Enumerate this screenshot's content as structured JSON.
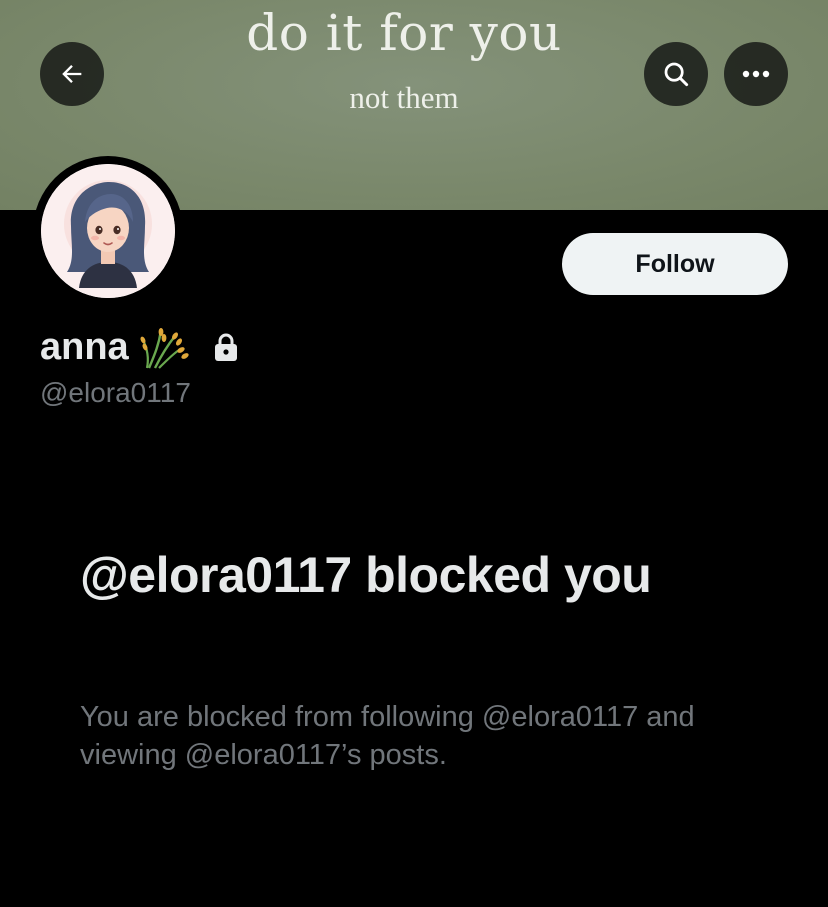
{
  "banner": {
    "title": "do it for you",
    "subtitle": "not them",
    "color": "#7b8a6c"
  },
  "header": {
    "back_icon": "arrow-left-icon",
    "search_icon": "search-icon",
    "more_icon": "more-horizontal-icon"
  },
  "profile": {
    "display_name": "anna",
    "name_emoji": "sheaf-of-rice-icon",
    "protected_icon": "lock-icon",
    "handle": "@elora0117",
    "follow_label": "Follow"
  },
  "blocked": {
    "heading": "@elora0117 blocked you",
    "body": "You are blocked from following @elora0117 and viewing @elora0117’s posts."
  },
  "colors": {
    "background": "#000000",
    "primary_text": "#e7e9ea",
    "secondary_text": "#71767b",
    "follow_button_bg": "#eff3f4"
  }
}
